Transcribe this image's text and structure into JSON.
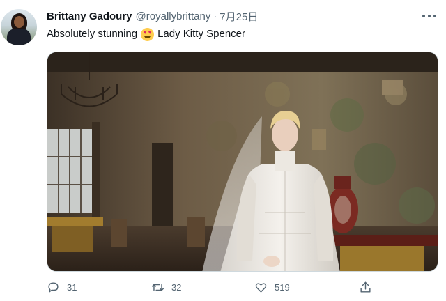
{
  "tweet": {
    "author_name": "Brittany Gadoury",
    "handle": "@royallybrittany",
    "separator": "·",
    "date": "7月25日",
    "text_before": "Absolutely stunning",
    "emoji": "heart-eyes-emoji",
    "text_after": "Lady Kitty Spencer",
    "media": {
      "type": "photo",
      "subject": "bride-in-lace-gown-in-ornate-room"
    }
  },
  "actions": {
    "reply_count": "31",
    "retweet_count": "32",
    "like_count": "519"
  },
  "icons": [
    "more-icon",
    "reply-icon",
    "retweet-icon",
    "like-icon",
    "share-icon"
  ],
  "colors": {
    "text": "#0f1419",
    "muted": "#536471",
    "border": "#cfd9de",
    "emoji": "#ffcc4d"
  }
}
